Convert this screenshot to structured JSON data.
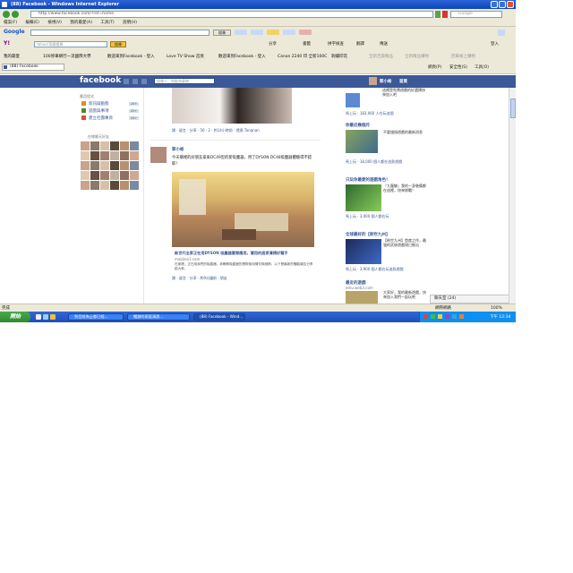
{
  "window": {
    "title": "(88) Facebook - Windows Internet Explorer"
  },
  "address": {
    "url": "http://www.facebook.com/?ref=home"
  },
  "search": {
    "placeholder": "Google"
  },
  "menu": [
    "檔案(F)",
    "編輯(E)",
    "檢視(V)",
    "我的最愛(A)",
    "工具(T)",
    "說明(H)"
  ],
  "google_bar": {
    "search_label": "搜尋",
    "placeholder": "Search"
  },
  "yahoo_bar": {
    "search_placeholder": "Yahoo!奇摩搜尋",
    "search_btn": "搜尋",
    "items": [
      "分享",
      "書籤",
      "拼字檢查",
      "翻譯",
      "傳送"
    ],
    "login": "登入"
  },
  "bookmarks": {
    "favorites": "我的最愛",
    "items": [
      "100停車網行一流國際大學",
      "歡迎來到Facebook - 登入",
      "Love TV Show 首頁",
      "歡迎來到Facebook - 登入",
      "Canon 2240 印 全新100C",
      "刺繡印花",
      "全新百貨精品",
      "全新精品購物",
      "回車線上購物"
    ]
  },
  "tab": {
    "label": "(88) Facebook"
  },
  "ie_tools": [
    "網頁(P)",
    "安全性(S)",
    "工具(O)"
  ],
  "fb": {
    "logo": "facebook",
    "search_placeholder": "搜尋人、地點和事物",
    "user_name": "郭小彬",
    "home_label": "首頁",
    "left_nav": {
      "header": "應用程式",
      "items": [
        {
          "label": "新訊與動態",
          "count": "20+"
        },
        {
          "label": "遊戲與事項",
          "count": "20+"
        },
        {
          "label": "建立社團專頁",
          "count": "20+"
        }
      ],
      "friends_header": "在線聊天好友"
    },
    "post1": {
      "meta": "讚 · 留言 · 分享 · 56 · 2 · 約14小時前 · 透過 Tanqnan"
    },
    "post2": {
      "author": "郭小彬",
      "text": "今天鄉裡的好朋友拿來DC49型的新吸塵器，用了DYSON DC48吸塵器體驗得不錯",
      "text2": "耶！",
      "link_title": "新世代全家正在用DYSON 吸塵器實際應用，實用的居家清掃好幫手",
      "link_domain": "mobileo1.com",
      "link_desc": "在家裡，正在用我們的吸塵器，來瞭解吸塵器的實際使用情況與細節，以下是最新的體驗報告分享給大家。",
      "actions": "讚 · 留言 · 分享 · 約9分鐘前 · 朋友"
    },
    "right_ads": [
      {
        "title": "",
        "text": "這裡是免費遊戲的好選擇快來加入吧",
        "likes": "馬上玩 · 183,060 人在玩這個"
      },
      {
        "title": "你最近幾個月",
        "text": "不要錯過遊戲的最新消息",
        "likes": "馬上玩 · 18,000 個人都在這款遊戲"
      },
      {
        "title": "只玩你最愛的遊戲角色！",
        "text": "『九龍御』我的一身裝備都在這裡，快來挑戰！",
        "likes": "馬上玩 · 3,000 個人都在玩"
      },
      {
        "title": "全球最好的【劍世九州】",
        "text": "【劍世九州】首席之作，最強的武俠遊戲現已推出",
        "likes": "馬上玩 · 3,900 個人都在玩這款遊戲"
      },
      {
        "title": "最近的遊戲",
        "text": "大家好，我的最新遊戲，快來加入我們一起玩吧",
        "domain": "emu.web3.com",
        "likes": ""
      }
    ],
    "chat": "聊天室 (24)"
  },
  "statusbar": {
    "left": "完成",
    "right": "網際網路",
    "zoom": "100%"
  },
  "taskbar": {
    "start": "開始",
    "tasks": [
      "到目前為止都已經...",
      "暢銷的家庭清潔...",
      "(88) Facebook - Wind..."
    ],
    "clock": "下午 12:34"
  },
  "colors": {
    "fb_blue": "#3b5998",
    "xp_blue": "#2458d0",
    "start_green": "#3c9a3c"
  }
}
